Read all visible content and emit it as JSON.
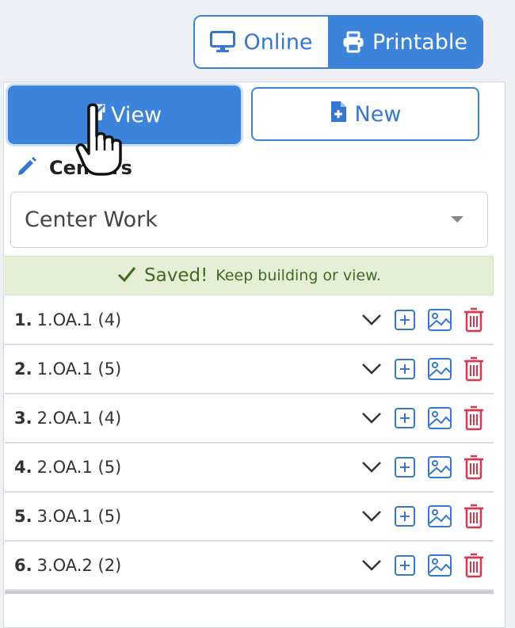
{
  "view_toggle": {
    "online_label": "Online",
    "printable_label": "Printable",
    "active": "Printable"
  },
  "actions": {
    "view_label": "View",
    "new_label": "New"
  },
  "section": {
    "label": "Centers",
    "select_value": "Center Work"
  },
  "alert": {
    "title": "Saved!",
    "message": "Keep building or view."
  },
  "items": [
    {
      "number": "1.",
      "text": "1.OA.1 (4)"
    },
    {
      "number": "2.",
      "text": "1.OA.1 (5)"
    },
    {
      "number": "3.",
      "text": "2.OA.1 (4)"
    },
    {
      "number": "4.",
      "text": "2.OA.1 (5)"
    },
    {
      "number": "5.",
      "text": "3.OA.1 (5)"
    },
    {
      "number": "6.",
      "text": "3.OA.2 (2)"
    }
  ],
  "colors": {
    "primary": "#3b83db",
    "success_bg": "#e4efd6",
    "success_text": "#3f6a23",
    "danger": "#d9374b"
  },
  "icons": [
    "monitor-icon",
    "printer-icon",
    "external-link-icon",
    "file-plus-icon",
    "pencil-icon",
    "chevron-down-icon",
    "plus-square-icon",
    "image-icon",
    "trash-icon",
    "check-icon",
    "hand-pointer-cursor"
  ]
}
